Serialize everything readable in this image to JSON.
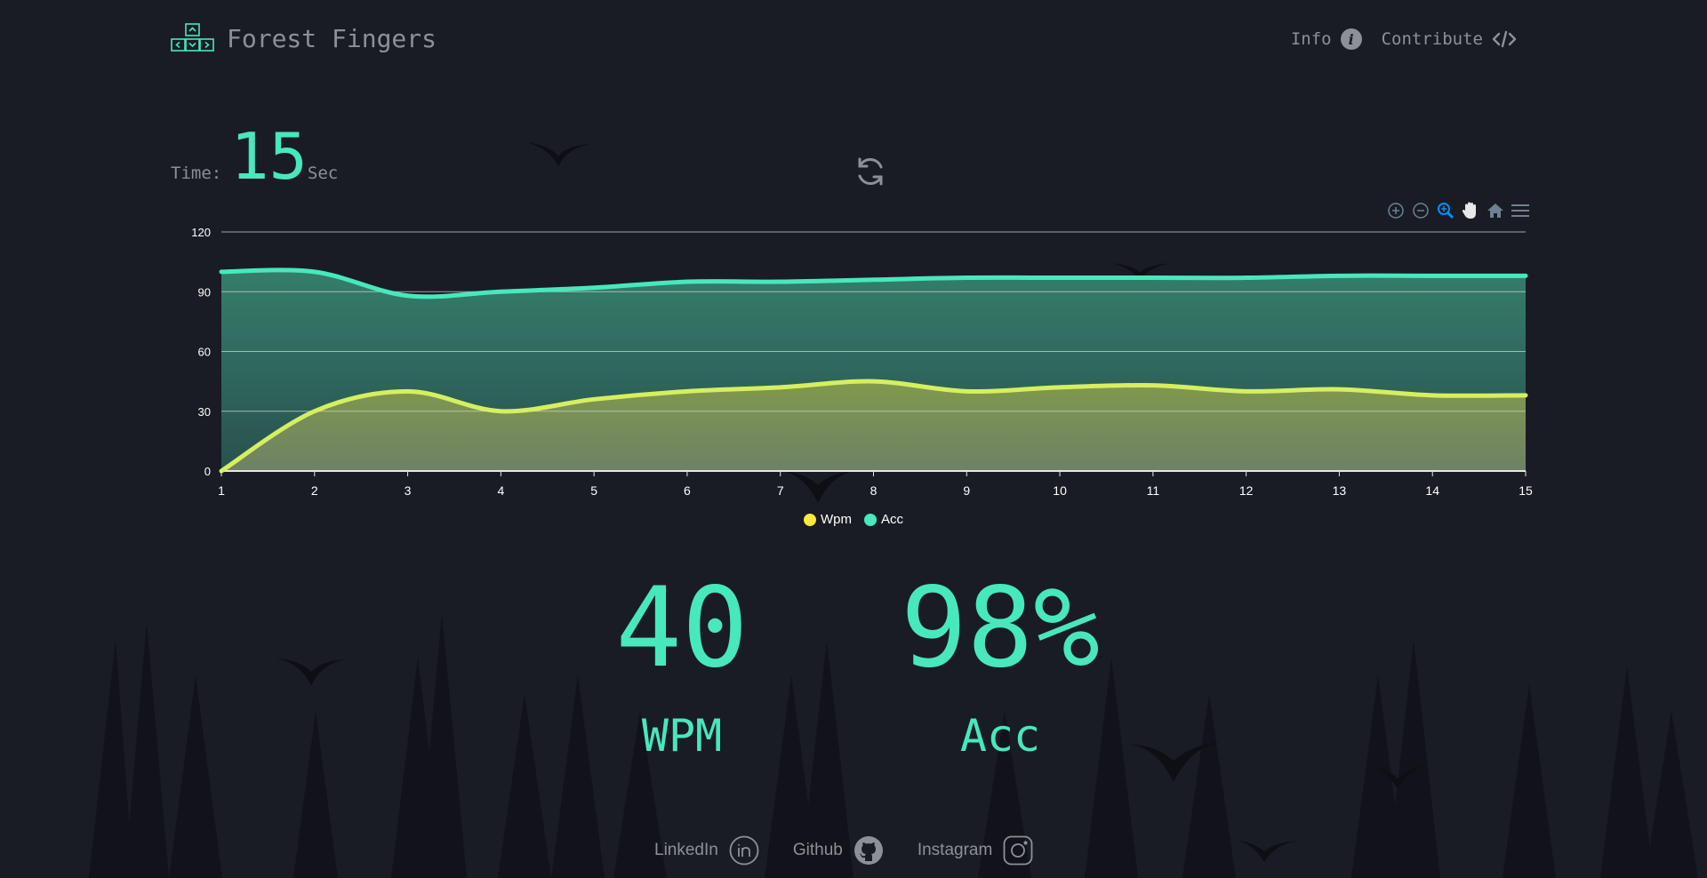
{
  "header": {
    "app_title": "Forest Fingers",
    "nav": [
      {
        "label": "Info",
        "icon": "info-icon"
      },
      {
        "label": "Contribute",
        "icon": "code-icon"
      }
    ]
  },
  "timer": {
    "label": "Time:",
    "value": "15",
    "unit": "Sec"
  },
  "toolbar": {
    "buttons": [
      "zoom-in-icon",
      "zoom-out-icon",
      "selection-zoom-icon",
      "pan-icon",
      "reset-home-icon",
      "menu-icon"
    ],
    "active": "selection-zoom-icon"
  },
  "chart_data": {
    "type": "area",
    "x": [
      1,
      2,
      3,
      4,
      5,
      6,
      7,
      8,
      9,
      10,
      11,
      12,
      13,
      14,
      15
    ],
    "series": [
      {
        "name": "Wpm",
        "color": "#fce93a",
        "values": [
          0,
          30,
          40,
          30,
          36,
          40,
          42,
          45,
          40,
          42,
          43,
          40,
          41,
          38,
          38
        ]
      },
      {
        "name": "Acc",
        "color": "#47e8bc",
        "values": [
          100,
          100,
          88,
          90,
          92,
          95,
          95,
          96,
          97,
          97,
          97,
          97,
          98,
          98,
          98
        ]
      }
    ],
    "ylim": [
      0,
      120
    ],
    "yticks": [
      0,
      30,
      60,
      90,
      120
    ],
    "grid": true,
    "legend": "bottom-center"
  },
  "stats": {
    "wpm_value": "40",
    "wpm_label": "WPM",
    "acc_value": "98%",
    "acc_label": "Acc"
  },
  "footer": {
    "links": [
      {
        "label": "LinkedIn",
        "icon": "linkedin-icon"
      },
      {
        "label": "Github",
        "icon": "github-icon"
      },
      {
        "label": "Instagram",
        "icon": "instagram-icon"
      }
    ]
  },
  "colors": {
    "background": "#191c24",
    "accent": "#47e8bc",
    "wpm": "#fce93a",
    "muted": "#8d9096"
  }
}
